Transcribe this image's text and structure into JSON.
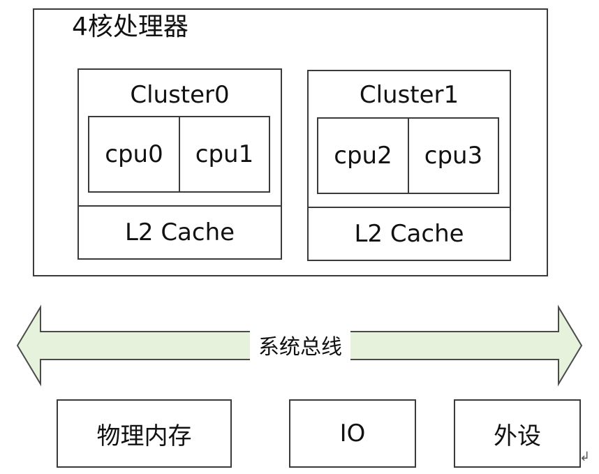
{
  "processor": {
    "title": "4核处理器",
    "clusters": [
      {
        "name": "Cluster0",
        "cpus": [
          "cpu0",
          "cpu1"
        ],
        "cache": "L2 Cache"
      },
      {
        "name": "Cluster1",
        "cpus": [
          "cpu2",
          "cpu3"
        ],
        "cache": "L2 Cache"
      }
    ]
  },
  "bus": {
    "label": "系统总线",
    "fill_color": "#e6f2dc",
    "stroke_color": "#4a4a4a"
  },
  "peripherals": [
    "物理内存",
    "IO",
    "外设"
  ],
  "colors": {
    "border": "#3a3a3a",
    "background": "#ffffff"
  }
}
